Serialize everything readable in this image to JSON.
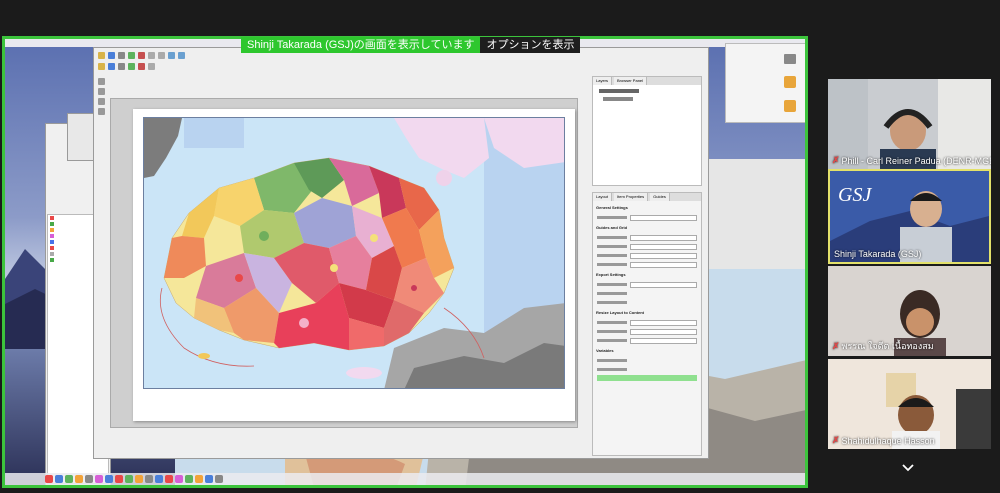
{
  "share_banner": {
    "text": "Shinji Takarada (GSJ)の画面を表示しています",
    "options": "オプションを表示"
  },
  "qgis": {
    "dock_tabs": [
      "Layers",
      "Browser Panel"
    ],
    "props_tabs": [
      "Layout",
      "Item Properties",
      "Guides"
    ],
    "sections": [
      "General Settings",
      "Guides and Grid",
      "Export Settings",
      "Resize Layout to Content",
      "Variables"
    ]
  },
  "participants": [
    {
      "name": "Phill - Carl Reiner Padua (DENR-MGB)",
      "muted": true
    },
    {
      "name": "Shinji Takarada (GSJ)",
      "muted": false,
      "active": true
    },
    {
      "name": "พรรณ ใจดีต เนื้อทองสม",
      "muted": true
    },
    {
      "name": "Shahidulhaque Hasson",
      "muted": true
    }
  ],
  "icons": {
    "mic_off": "mic-off-icon",
    "expand": "chevron-down-icon"
  },
  "colors": {
    "share_border": "#3cc43c",
    "active_speaker": "#e3e16a",
    "mic_off": "#e14848"
  }
}
